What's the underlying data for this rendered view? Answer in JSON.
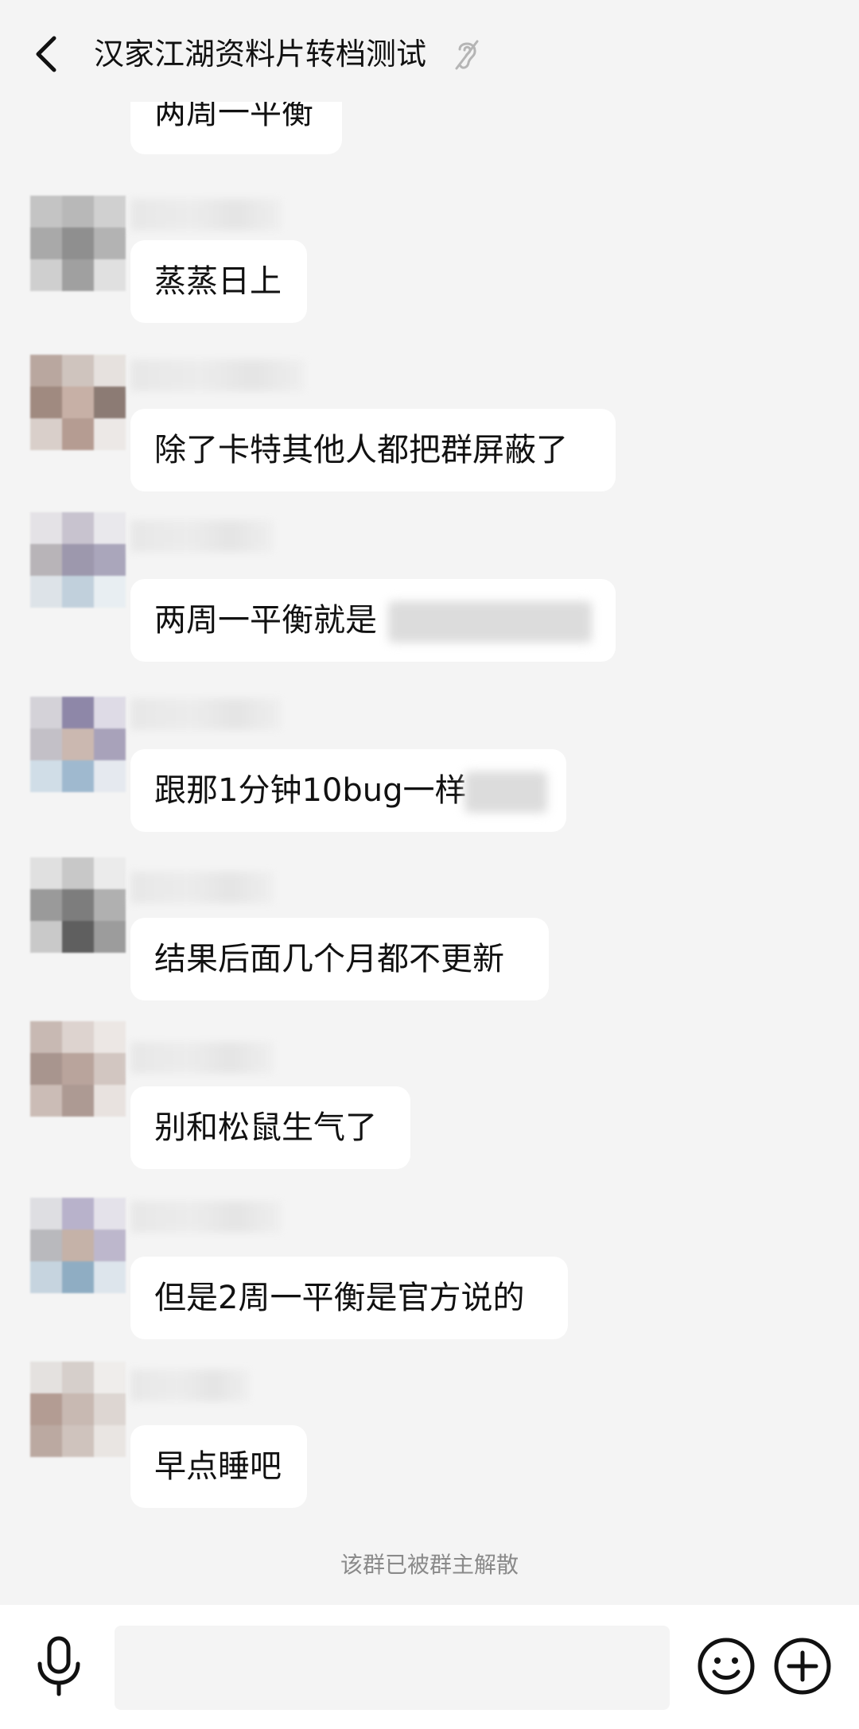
{
  "header": {
    "title": "汉家江湖资料片转档测试",
    "back_icon": "chevron-left-icon",
    "mute_icon": "ear-icon"
  },
  "messages": [
    {
      "text": "两周一平衡"
    },
    {
      "text": "蒸蒸日上"
    },
    {
      "text": "除了卡特其他人都把群屏蔽了"
    },
    {
      "text": "两周一平衡就是"
    },
    {
      "text": "跟那1分钟10bug一样"
    },
    {
      "text": "结果后面几个月都不更新"
    },
    {
      "text": "别和松鼠生气了"
    },
    {
      "text": "但是2周一平衡是官方说的"
    },
    {
      "text": "早点睡吧"
    }
  ],
  "notice": "该群已被群主解散",
  "input": {
    "placeholder": "",
    "mic_icon": "microphone-icon",
    "emoji_icon": "emoji-icon",
    "plus_icon": "plus-icon"
  },
  "colors": {
    "background": "#f4f4f4",
    "bubble": "#ffffff",
    "notice_text": "#8a8a8a"
  }
}
